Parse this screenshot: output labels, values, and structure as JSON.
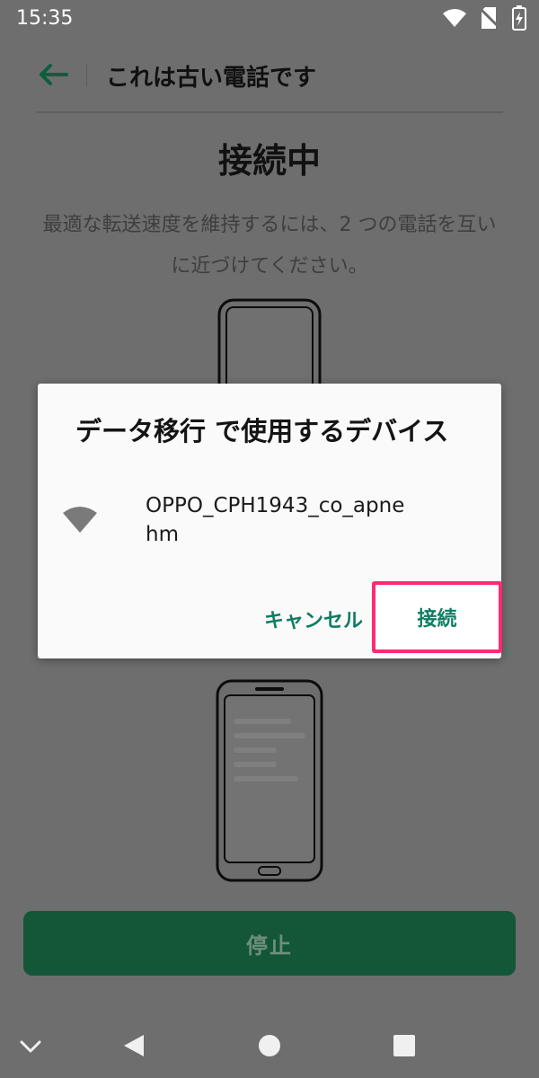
{
  "status_bar": {
    "time": "15:35"
  },
  "header": {
    "title": "これは古い電話です"
  },
  "main": {
    "title": "接続中",
    "description": "最適な転送速度を維持するには、2 つの電話を互いに近づけてください。",
    "stop_label": "停止"
  },
  "dialog": {
    "title": "データ移行 で使用するデバイス",
    "device_name": "OPPO_CPH1943_co_apnehm",
    "cancel_label": "キャンセル",
    "connect_label": "接続"
  },
  "colors": {
    "accent_green": "#0f7d63",
    "highlight_pink": "#ff2a74",
    "stop_button": "#135638"
  },
  "icons": [
    "back-arrow-icon",
    "wifi-status-icon",
    "no-sim-icon",
    "battery-charging-icon",
    "wifi-icon",
    "nav-collapse-icon",
    "nav-back-icon",
    "nav-home-icon",
    "nav-recents-icon"
  ]
}
